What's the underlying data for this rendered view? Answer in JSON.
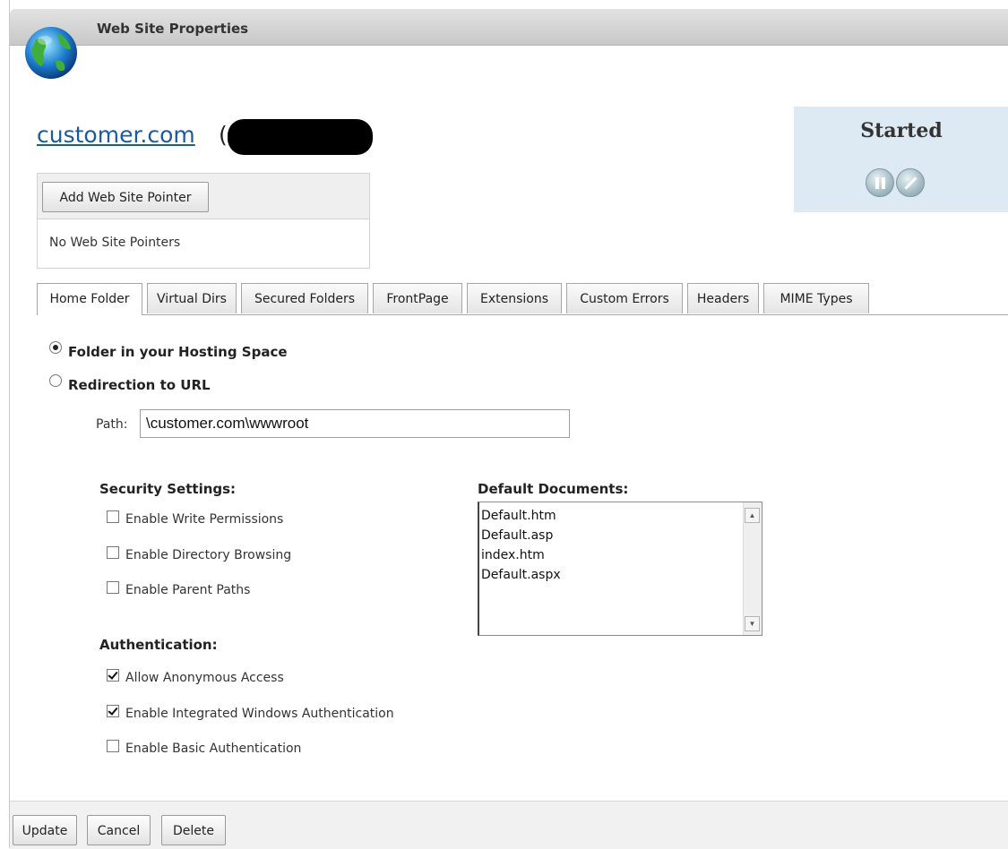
{
  "window": {
    "title": "Web Site Properties"
  },
  "site": {
    "name": "customer.com",
    "paren": "("
  },
  "pointers": {
    "add_button": "Add Web Site Pointer",
    "empty_text": "No Web Site Pointers"
  },
  "status": {
    "label": "Started"
  },
  "tabs": [
    {
      "label": "Home Folder",
      "active": true
    },
    {
      "label": "Virtual Dirs",
      "active": false
    },
    {
      "label": "Secured Folders",
      "active": false
    },
    {
      "label": "FrontPage",
      "active": false
    },
    {
      "label": "Extensions",
      "active": false
    },
    {
      "label": "Custom Errors",
      "active": false
    },
    {
      "label": "Headers",
      "active": false
    },
    {
      "label": "MIME Types",
      "active": false
    }
  ],
  "home_folder": {
    "options": [
      {
        "label": "Folder in your Hosting Space",
        "checked": true
      },
      {
        "label": "Redirection to URL",
        "checked": false
      }
    ],
    "path_label": "Path:",
    "path_value": "\\customer.com\\wwwroot"
  },
  "security": {
    "heading": "Security Settings:",
    "items": [
      {
        "label": "Enable Write Permissions",
        "checked": false
      },
      {
        "label": "Enable Directory Browsing",
        "checked": false
      },
      {
        "label": "Enable Parent Paths",
        "checked": false
      }
    ]
  },
  "authentication": {
    "heading": "Authentication:",
    "items": [
      {
        "label": "Allow Anonymous Access",
        "checked": true
      },
      {
        "label": "Enable Integrated Windows Authentication",
        "checked": true
      },
      {
        "label": "Enable Basic Authentication",
        "checked": false
      }
    ]
  },
  "default_documents": {
    "heading": "Default Documents:",
    "items": [
      "Default.htm",
      "Default.asp",
      "index.htm",
      "Default.aspx"
    ]
  },
  "footer": {
    "update": "Update",
    "cancel": "Cancel",
    "delete": "Delete"
  },
  "icons": {
    "globe": "globe-icon",
    "pause": "pause-icon",
    "stop": "stop-icon",
    "scroll_up": "scroll-up-arrow-icon",
    "scroll_down": "scroll-down-arrow-icon"
  }
}
